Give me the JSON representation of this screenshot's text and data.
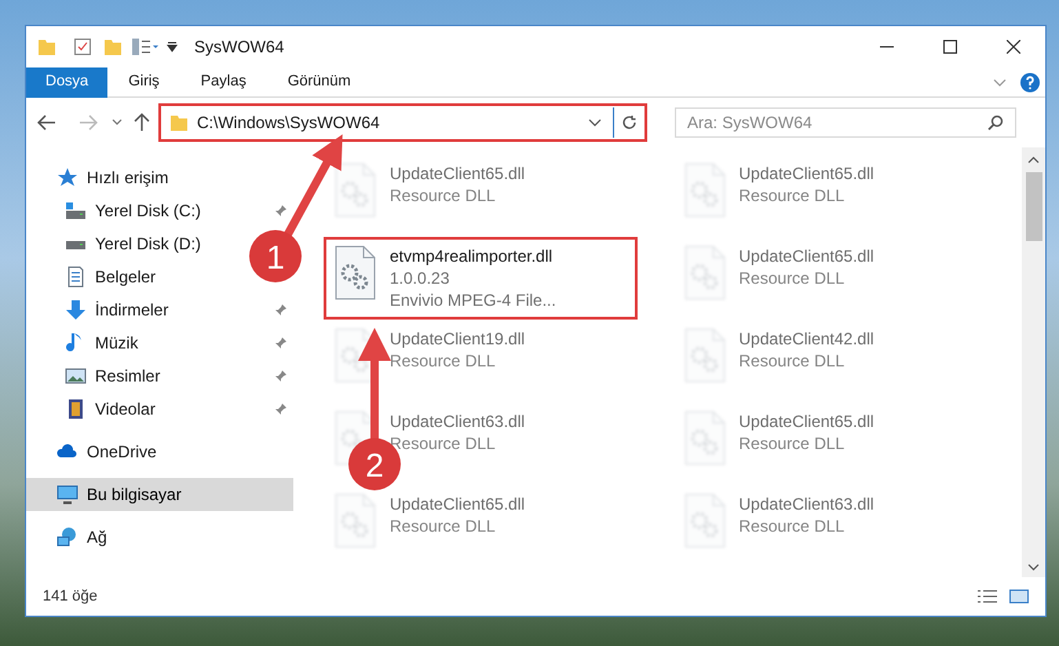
{
  "window": {
    "title": "SysWOW64"
  },
  "ribbon_tabs": [
    {
      "label": "Dosya",
      "kind": "file"
    },
    {
      "label": "Giriş",
      "kind": "tab"
    },
    {
      "label": "Paylaş",
      "kind": "tab"
    },
    {
      "label": "Görünüm",
      "kind": "tab"
    }
  ],
  "address_bar": {
    "path": "C:\\Windows\\SysWOW64",
    "highlighted": true
  },
  "search": {
    "placeholder": "Ara: SysWOW64"
  },
  "sidebar": {
    "items": [
      {
        "label": "Hızlı erişim",
        "kind": "star",
        "selected": false,
        "children": [
          {
            "label": "Yerel Disk (C:)",
            "kind": "drive-c",
            "pinned": true,
            "selected": false
          },
          {
            "label": "Yerel Disk (D:)",
            "kind": "drive",
            "pinned": false,
            "selected": false
          },
          {
            "label": "Belgeler",
            "kind": "document",
            "pinned": false,
            "selected": false
          },
          {
            "label": "İndirmeler",
            "kind": "download",
            "pinned": true,
            "selected": false
          },
          {
            "label": "Müzik",
            "kind": "music",
            "pinned": true,
            "selected": false
          },
          {
            "label": "Resimler",
            "kind": "picture",
            "pinned": true,
            "selected": false
          },
          {
            "label": "Videolar",
            "kind": "video",
            "pinned": true,
            "selected": false
          }
        ]
      },
      {
        "label": "OneDrive",
        "kind": "cloud",
        "selected": false
      },
      {
        "label": "Bu bilgisayar",
        "kind": "computer",
        "selected": true
      },
      {
        "label": "Ağ",
        "kind": "network",
        "selected": false
      }
    ]
  },
  "files": [
    {
      "name": "UpdateClient65.dll",
      "details": [
        "Resource DLL"
      ],
      "blurred": true,
      "highlighted": false
    },
    {
      "name": "UpdateClient65.dll",
      "details": [
        "Resource DLL"
      ],
      "blurred": true,
      "highlighted": false
    },
    {
      "name": "etvmp4realimporter.dll",
      "details": [
        "1.0.0.23",
        "Envivio MPEG-4 File..."
      ],
      "blurred": false,
      "highlighted": true
    },
    {
      "name": "UpdateClient65.dll",
      "details": [
        "Resource DLL"
      ],
      "blurred": true,
      "highlighted": false
    },
    {
      "name": "UpdateClient19.dll",
      "details": [
        "Resource DLL"
      ],
      "blurred": true,
      "highlighted": false
    },
    {
      "name": "UpdateClient42.dll",
      "details": [
        "Resource DLL"
      ],
      "blurred": true,
      "highlighted": false
    },
    {
      "name": "UpdateClient63.dll",
      "details": [
        "Resource DLL"
      ],
      "blurred": true,
      "highlighted": false
    },
    {
      "name": "UpdateClient65.dll",
      "details": [
        "Resource DLL"
      ],
      "blurred": true,
      "highlighted": false
    },
    {
      "name": "UpdateClient65.dll",
      "details": [
        "Resource DLL"
      ],
      "blurred": true,
      "highlighted": false
    },
    {
      "name": "UpdateClient63.dll",
      "details": [
        "Resource DLL"
      ],
      "blurred": true,
      "highlighted": false
    }
  ],
  "status_bar": {
    "count": "141 öğe"
  },
  "annotations": [
    {
      "number": "1"
    },
    {
      "number": "2"
    }
  ]
}
